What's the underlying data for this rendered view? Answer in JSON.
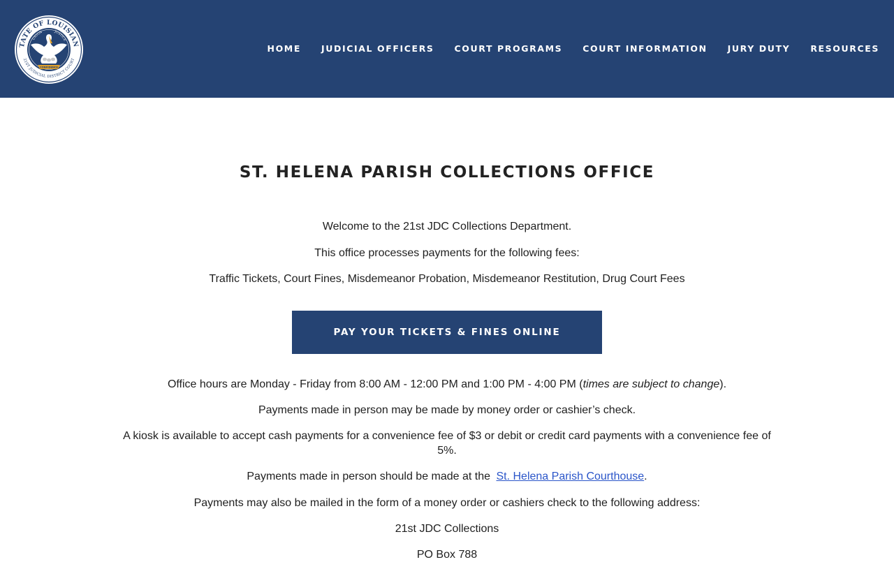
{
  "header": {
    "seal_ring_top": "STATE OF LOUISIANA",
    "seal_motto_left": "UNION",
    "seal_motto_right": "JUSTICE",
    "seal_banner": "CONFIDENCE",
    "seal_ring_bottom": "21ST JUDICIAL DISTRICT COURT",
    "nav": [
      {
        "label": "HOME"
      },
      {
        "label": "JUDICIAL OFFICERS"
      },
      {
        "label": "COURT PROGRAMS"
      },
      {
        "label": "COURT INFORMATION"
      },
      {
        "label": "JURY DUTY"
      },
      {
        "label": "RESOURCES"
      }
    ],
    "colors": {
      "brand": "#254373",
      "link": "#2a55c9"
    }
  },
  "main": {
    "title": "ST. HELENA PARISH COLLECTIONS OFFICE",
    "welcome": "Welcome to the 21st JDC Collections Department.",
    "processes": "This office processes payments for the following fees:",
    "fees": "Traffic Tickets, Court Fines, Misdemeanor Probation, Misdemeanor Restitution, Drug Court Fees",
    "pay_button": "PAY YOUR TICKETS & FINES ONLINE",
    "hours_prefix": "Office hours are Monday - Friday from 8:00 AM - 12:00 PM and 1:00 PM - 4:00 PM (",
    "hours_note": "times are subject to change",
    "hours_suffix": ").",
    "in_person": "Payments made in person may be made by money order or cashier’s check.",
    "kiosk": "A kiosk is available to accept cash payments for a convenience fee of $3 or debit or credit card payments with a convenience fee of 5%.",
    "location_prefix": "Payments made in person should be made at the",
    "location_link": "St. Helena Parish Courthouse",
    "location_suffix": ".",
    "mail": "Payments may also be mailed in the form of a money order or cashiers check  to the following address:",
    "address_line1": "21st JDC Collections",
    "address_line2": "PO Box 788"
  }
}
